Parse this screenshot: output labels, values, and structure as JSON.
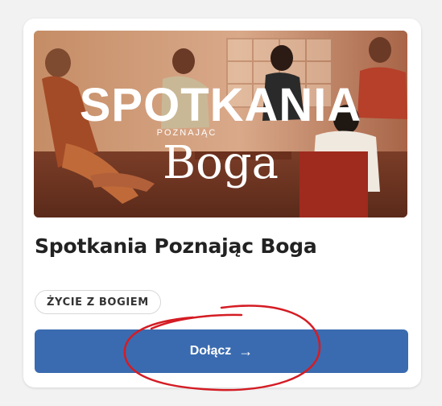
{
  "card": {
    "image": {
      "wordmark_main": "SPOTKANIA",
      "wordmark_sub": "POZNAJĄC",
      "wordmark_script": "Boga"
    },
    "title": "Spotkania Poznając Boga",
    "tag": "ŻYCIE Z BOGIEM",
    "join_button": {
      "label": "Dołącz",
      "icon": "arrow-right-icon"
    }
  },
  "colors": {
    "button": "#3a6bb0",
    "annotation": "#d41c24"
  }
}
